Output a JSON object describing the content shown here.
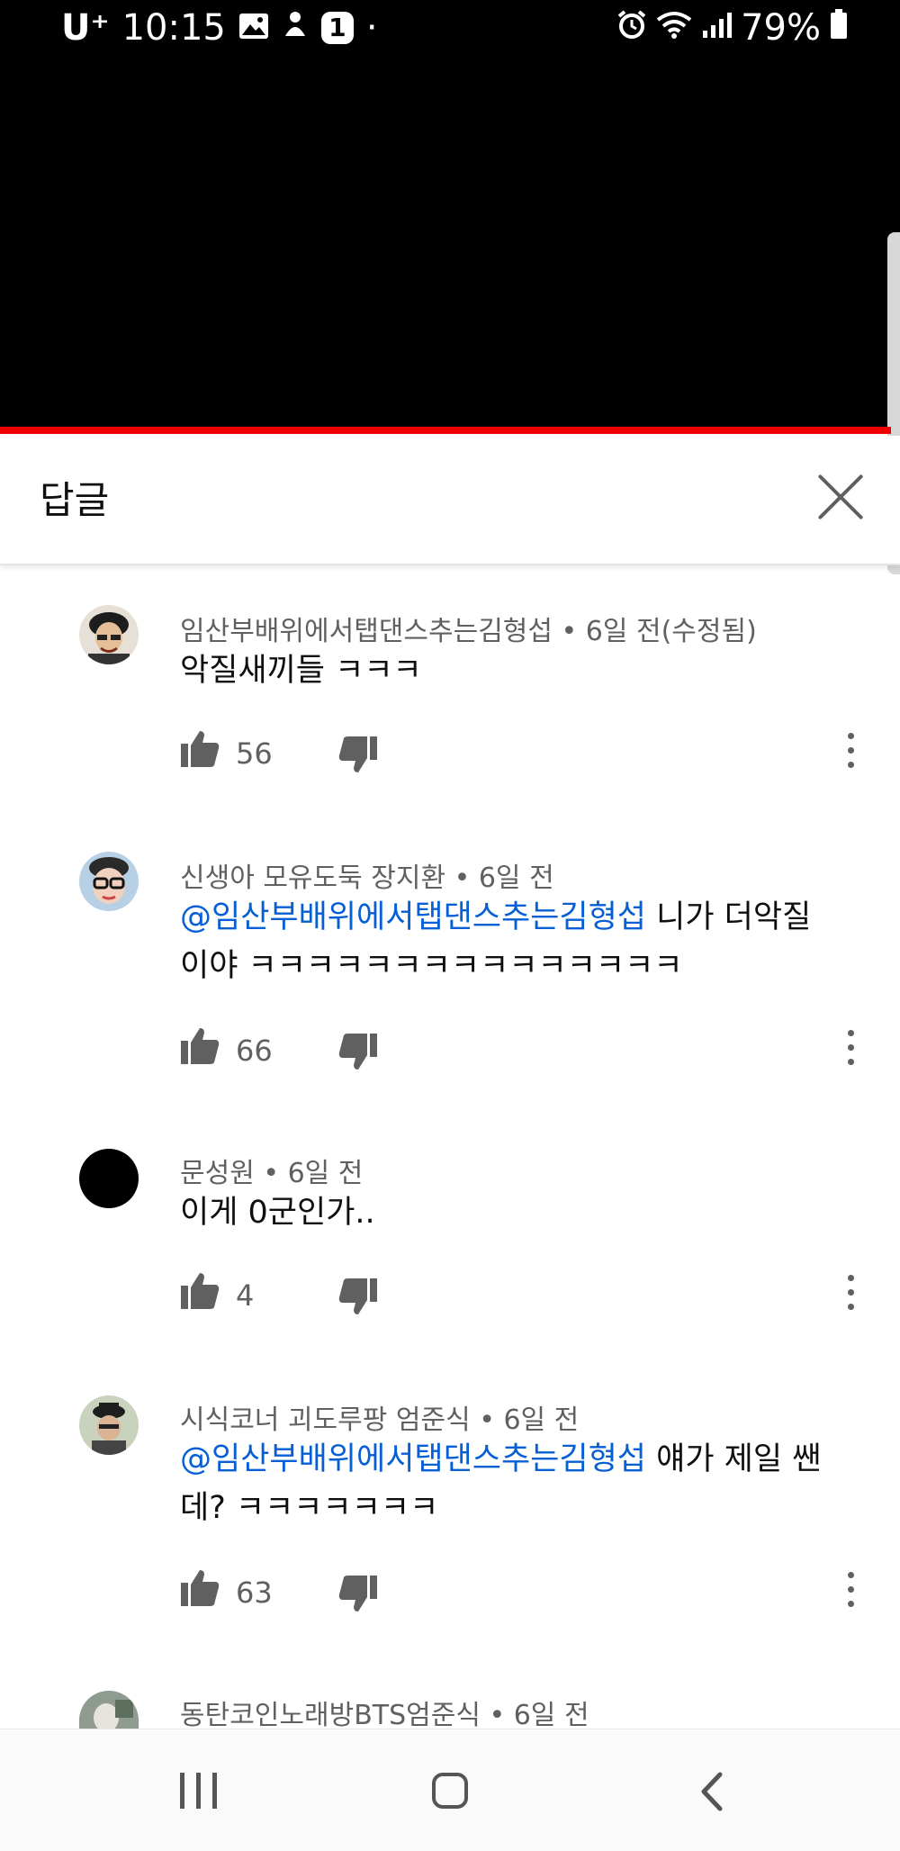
{
  "status_bar": {
    "carrier": "U⁺",
    "time": "10:15",
    "notification_badge": "1",
    "dot": "·",
    "battery": "79%",
    "icons_left": [
      "image-icon",
      "assistant-icon",
      "badge-icon"
    ],
    "icons_right": [
      "alarm-icon",
      "wifi-icon",
      "signal-icon",
      "battery-icon"
    ]
  },
  "header": {
    "title": "답글",
    "close_icon": "close-icon"
  },
  "comments": [
    {
      "author": "임산부배위에서탭댄스추는김형섭",
      "meta": "임산부배위에서탭댄스추는김형섭 • 6일 전(수정됨)",
      "mention": "",
      "text": "악질새끼들 ㅋㅋㅋ",
      "likes": "56",
      "avatar_color": "#d9c7a8"
    },
    {
      "author": "신생아 모유도둑 장지환",
      "meta": "신생아 모유도둑 장지환 • 6일 전",
      "mention": "@임산부배위에서탭댄스추는김형섭",
      "text": " 니가 더악질이야 ㅋㅋㅋㅋㅋㅋㅋㅋㅋㅋㅋㅋㅋㅋㅋ",
      "likes": "66",
      "avatar_color": "#c7d8ea"
    },
    {
      "author": "문성원",
      "meta": "문성원 • 6일 전",
      "mention": "",
      "text": "이게 0군인가..",
      "likes": "4",
      "avatar_color": "#000000"
    },
    {
      "author": "시식코너 괴도루팡 엄준식",
      "meta": "시식코너 괴도루팡 엄준식 • 6일 전",
      "mention": "@임산부배위에서탭댄스추는김형섭",
      "text": " 얘가 제일 쌘데? ㅋㅋㅋㅋㅋㅋㅋ",
      "likes": "63",
      "avatar_color": "#b9c4a4"
    },
    {
      "author": "동탄코인노래방BTS엄준식",
      "meta": "동탄코인노래방BTS엄준식 • 6일 전",
      "mention": "",
      "text": "",
      "likes": "",
      "avatar_color": "#9aa39a"
    }
  ],
  "colors": {
    "accent_red": "#ee0000",
    "mention_blue": "#065fd4",
    "meta_gray": "#606060"
  },
  "nav_bar": {
    "items": [
      "recent-apps-icon",
      "home-icon",
      "back-icon"
    ]
  }
}
